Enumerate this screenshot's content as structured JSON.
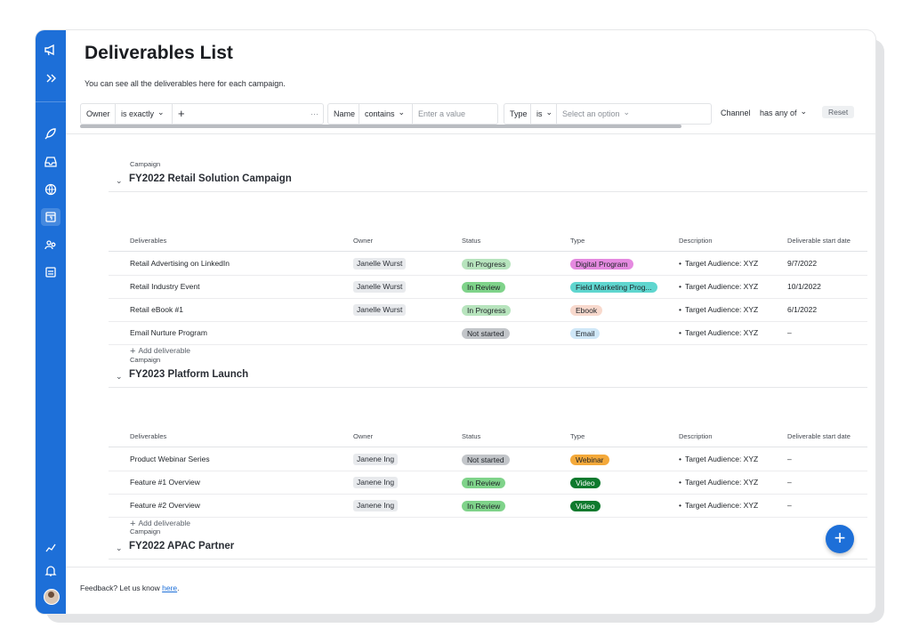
{
  "page": {
    "title": "Deliverables List",
    "subtitle": "You can see all the deliverables here for each campaign.",
    "feedback_text": "Feedback? Let us know ",
    "feedback_link": "here",
    "feedback_period": "."
  },
  "filters": {
    "owner": {
      "label": "Owner",
      "operator": "is exactly",
      "add": "+",
      "more": "···"
    },
    "name": {
      "label": "Name",
      "operator": "contains",
      "placeholder": "Enter a value"
    },
    "type": {
      "label": "Type",
      "operator": "is",
      "placeholder": "Select an option"
    },
    "channel": {
      "label": "Channel",
      "operator": "has any of"
    },
    "reset": "Reset"
  },
  "columns": [
    "Deliverables",
    "Owner",
    "Status",
    "Type",
    "Description",
    "Deliverable start date"
  ],
  "campaign_label": "Campaign",
  "add_deliverable": "Add deliverable",
  "campaigns": [
    {
      "name": "FY2022 Retail Solution Campaign",
      "rows": [
        {
          "deliverable": "Retail Advertising on LinkedIn",
          "owner": "Janelle Wurst",
          "status": "In Progress",
          "status_color": "#b7e4bd",
          "type": "Digital Program",
          "type_color": "#e58ae0",
          "description": "Target Audience: XYZ",
          "start": "9/7/2022"
        },
        {
          "deliverable": "Retail Industry Event",
          "owner": "Janelle Wurst",
          "status": "In Review",
          "status_color": "#7fd38a",
          "type": "Field Marketing Prog...",
          "type_color": "#5fd6cf",
          "description": "Target Audience: XYZ",
          "start": "10/1/2022"
        },
        {
          "deliverable": "Retail eBook #1",
          "owner": "Janelle Wurst",
          "status": "In Progress",
          "status_color": "#b7e4bd",
          "type": "Ebook",
          "type_color": "#f8d9cd",
          "description": "Target Audience: XYZ",
          "start": "6/1/2022"
        },
        {
          "deliverable": "Email Nurture Program",
          "owner": "",
          "status": "Not started",
          "status_color": "#c2c5c9",
          "type": "Email",
          "type_color": "#cfe7f7",
          "description": "Target Audience: XYZ",
          "start": "–"
        }
      ]
    },
    {
      "name": "FY2023 Platform Launch",
      "rows": [
        {
          "deliverable": "Product Webinar Series",
          "owner": "Janene Ing",
          "status": "Not started",
          "status_color": "#c2c5c9",
          "type": "Webinar",
          "type_color": "#f4a93a",
          "description": "Target Audience: XYZ",
          "start": "–"
        },
        {
          "deliverable": "Feature #1 Overview",
          "owner": "Janene Ing",
          "status": "In Review",
          "status_color": "#7fd38a",
          "type": "Video",
          "type_color": "#0f7a2e",
          "description": "Target Audience: XYZ",
          "start": "–"
        },
        {
          "deliverable": "Feature #2 Overview",
          "owner": "Janene Ing",
          "status": "In Review",
          "status_color": "#7fd38a",
          "type": "Video",
          "type_color": "#0f7a2e",
          "description": "Target Audience: XYZ",
          "start": "–"
        }
      ]
    },
    {
      "name": "FY2022 APAC Partner",
      "rows": []
    }
  ],
  "fab_label": "+",
  "colors": {
    "accent": "#1d6fd8",
    "rail": "#1d6fd8"
  }
}
